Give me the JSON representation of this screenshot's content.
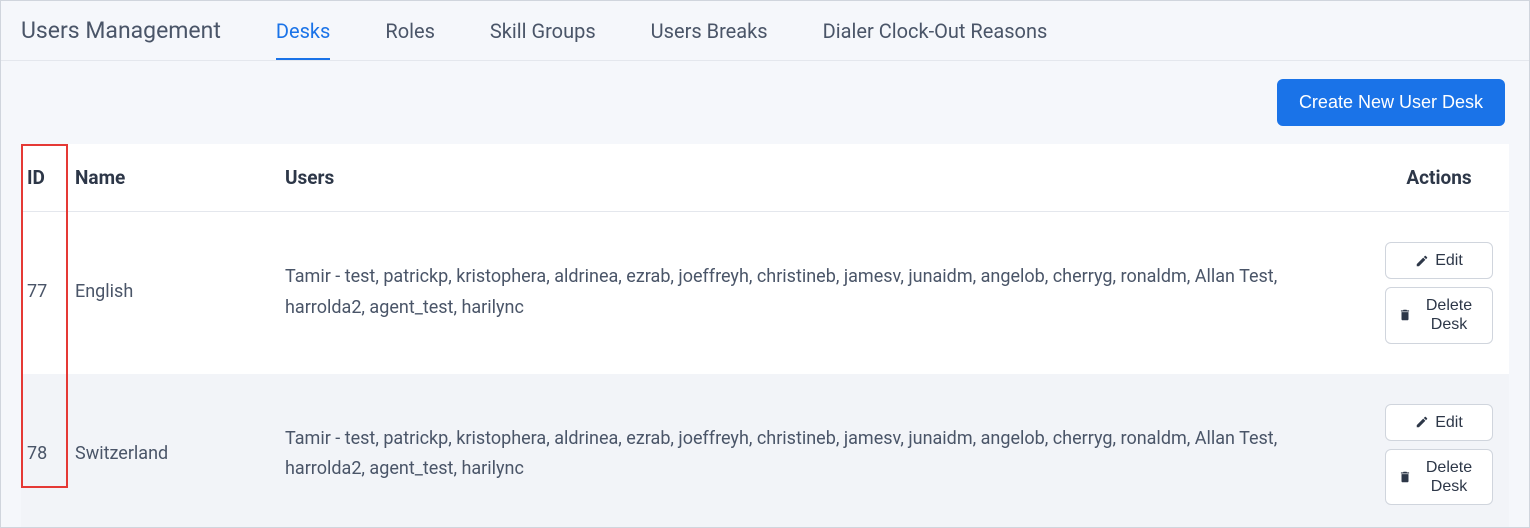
{
  "header": {
    "title": "Users Management",
    "tabs": [
      {
        "label": "Desks",
        "active": true
      },
      {
        "label": "Roles",
        "active": false
      },
      {
        "label": "Skill Groups",
        "active": false
      },
      {
        "label": "Users Breaks",
        "active": false
      },
      {
        "label": "Dialer Clock-Out Reasons",
        "active": false
      }
    ]
  },
  "buttons": {
    "create": "Create New User Desk",
    "edit": "Edit",
    "delete": "Delete Desk"
  },
  "table": {
    "columns": {
      "id": "ID",
      "name": "Name",
      "users": "Users",
      "actions": "Actions"
    },
    "rows": [
      {
        "id": "77",
        "name": "English",
        "users": "Tamir - test, patrickp, kristophera, aldrinea, ezrab, joeffreyh, christineb, jamesv, junaidm, angelob, cherryg, ronaldm, Allan Test, harrolda2, agent_test, harilync"
      },
      {
        "id": "78",
        "name": "Switzerland",
        "users": "Tamir - test, patrickp, kristophera, aldrinea, ezrab, joeffreyh, christineb, jamesv, junaidm, angelob, cherryg, ronaldm, Allan Test, harrolda2, agent_test, harilync"
      }
    ]
  }
}
